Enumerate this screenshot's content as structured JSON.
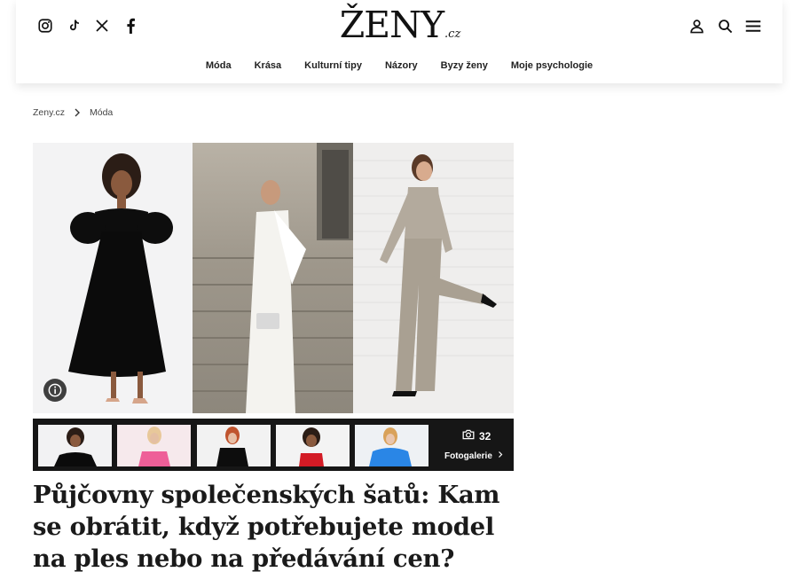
{
  "header": {
    "logo_main": "ŽENY",
    "logo_tld": ".cz",
    "social": [
      "instagram-icon",
      "tiktok-icon",
      "x-icon",
      "facebook-icon"
    ],
    "tools": [
      "user-icon",
      "search-icon",
      "menu-icon"
    ]
  },
  "nav": {
    "items": [
      "Móda",
      "Krása",
      "Kulturní tipy",
      "Názory",
      "Byzy ženy",
      "Moje psychologie"
    ]
  },
  "breadcrumb": {
    "home": "Zeny.cz",
    "current": "Móda"
  },
  "gallery": {
    "count": "32",
    "link_label": "Fotogalerie",
    "thumbs": 5
  },
  "article": {
    "title": "Půjčovny společenských šatů: Kam se obrátit, když potřebujete model na ples nebo na předávání cen?"
  },
  "colors": {
    "strip_bg": "#161616",
    "text": "#111111"
  }
}
